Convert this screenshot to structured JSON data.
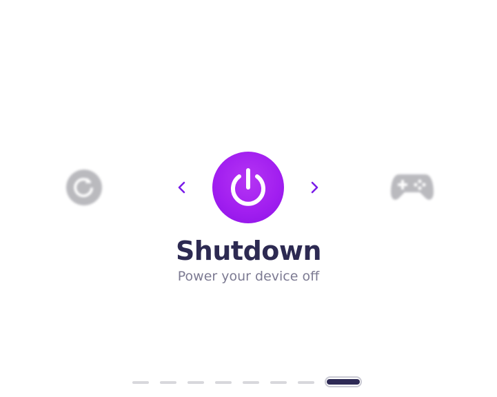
{
  "carousel": {
    "current": {
      "title": "Shutdown",
      "subtitle": "Power your device off",
      "icon": "power-icon",
      "gradient_colors": [
        "#b535f3",
        "#8c12e6"
      ]
    },
    "previous_icon": "restart-icon",
    "next_icon": "gamepad-icon",
    "prev_arrow_icon": "chevron-left-icon",
    "next_arrow_icon": "chevron-right-icon",
    "accent_color": "#7a1ce8"
  },
  "pagination": {
    "total": 8,
    "active_index": 7
  },
  "colors": {
    "title": "#2d2a52",
    "subtitle": "#7c7a92",
    "inactive_dot": "#d8d8dc",
    "active_dot": "#2e2a55",
    "side_icon": "#b3b3b8"
  }
}
